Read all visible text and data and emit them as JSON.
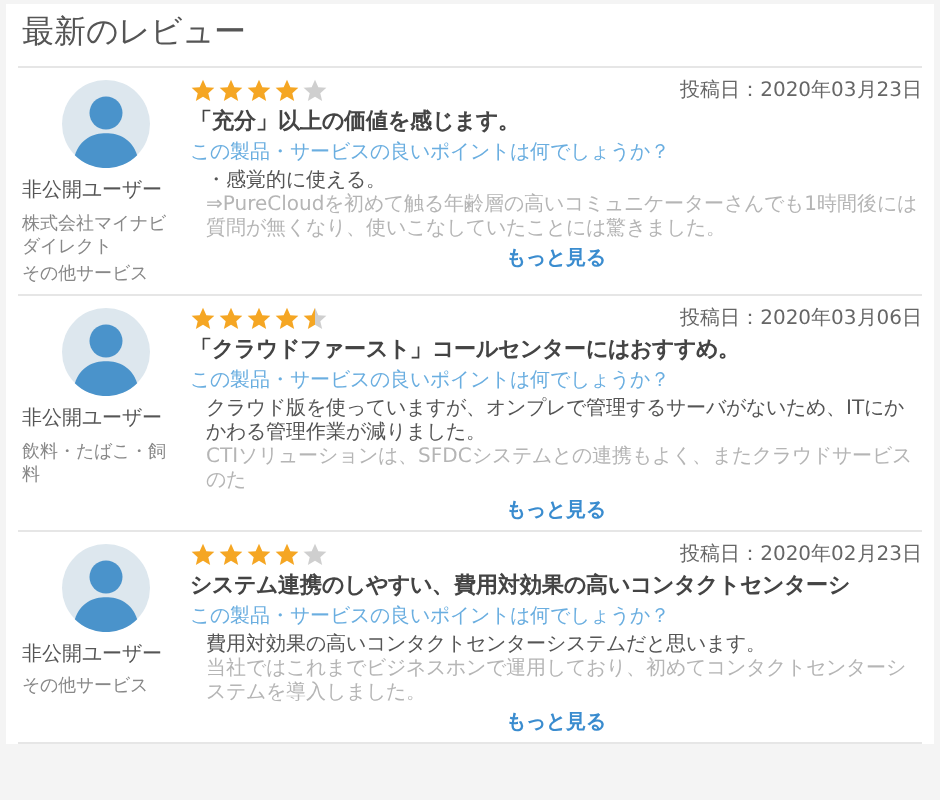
{
  "heading": "最新のレビュー",
  "reviews": [
    {
      "user": "非公開ユーザー",
      "company": [
        "株式会社マイナビダイレクト",
        "その他サービス"
      ],
      "stars": 4,
      "date": "投稿日：2020年03月23日",
      "title": "「充分」以上の価値を感じます。",
      "question": "この製品・サービスの良いポイントは何でしょうか？",
      "body": [
        "・感覚的に使える。",
        "⇒PureCloudを初めて触る年齢層の高いコミュニケーターさんでも1時間後には質問が無くなり、使いこなしていたことには驚きました。"
      ],
      "more": "もっと見る"
    },
    {
      "user": "非公開ユーザー",
      "company": [
        "飲料・たばこ・飼料"
      ],
      "stars": 4.5,
      "date": "投稿日：2020年03月06日",
      "title": "「クラウドファースト」コールセンターにはおすすめ。",
      "question": "この製品・サービスの良いポイントは何でしょうか？",
      "body": [
        "クラウド版を使っていますが、オンプレで管理するサーバがないため、ITにかかわる管理作業が減りました。",
        "CTIソリューションは、SFDCシステムとの連携もよく、またクラウドサービスのた"
      ],
      "more": "もっと見る"
    },
    {
      "user": "非公開ユーザー",
      "company": [
        "その他サービス"
      ],
      "stars": 4,
      "date": "投稿日：2020年02月23日",
      "title": "システム連携のしやすい、費用対効果の高いコンタクトセンターシ",
      "question": "この製品・サービスの良いポイントは何でしょうか？",
      "body": [
        "費用対効果の高いコンタクトセンターシステムだと思います。",
        "当社ではこれまでビジネスホンで運用しており、初めてコンタクトセンターシステムを導入しました。"
      ],
      "more": "もっと見る"
    }
  ]
}
